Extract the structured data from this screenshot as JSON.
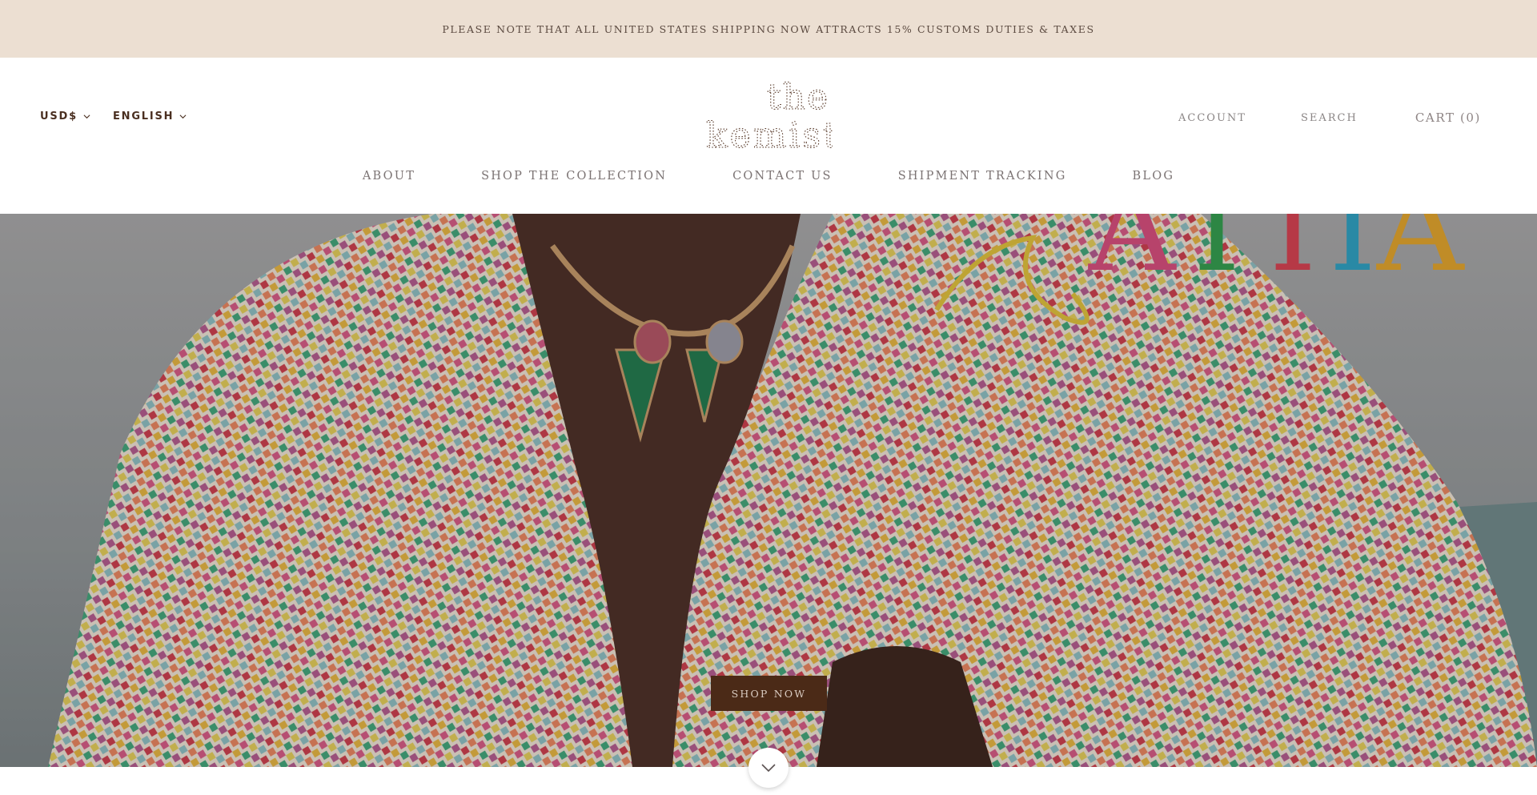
{
  "announcement": {
    "text": "PLEASE NOTE THAT ALL UNITED STATES SHIPPING NOW ATTRACTS 15% CUSTOMS DUTIES & TAXES"
  },
  "header": {
    "currency_label": "USD$",
    "language_label": "ENGLISH",
    "logo_line1": "the",
    "logo_line2": "kemist",
    "account_label": "ACCOUNT",
    "search_label": "SEARCH",
    "cart_label": "CART (0)"
  },
  "nav": {
    "items": [
      {
        "label": "ABOUT"
      },
      {
        "label": "SHOP THE COLLECTION"
      },
      {
        "label": "CONTACT US"
      },
      {
        "label": "SHIPMENT TRACKING"
      },
      {
        "label": "BLOG"
      }
    ]
  },
  "hero": {
    "shop_now_label": "SHOP NOW"
  },
  "icons": {
    "dropdown": "chevron-down-icon",
    "scroll": "chevron-down-icon"
  },
  "colors": {
    "announcement_bg": "#ecdfd2",
    "brand_brown": "#4b2a17",
    "nav_text": "#7b7373"
  }
}
